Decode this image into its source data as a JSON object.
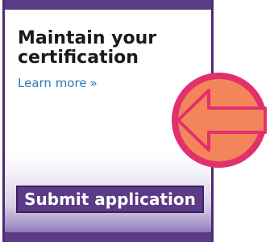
{
  "card": {
    "title": "Maintain your certification",
    "learn_more_label": "Learn more",
    "learn_more_chevron": "»",
    "submit_label": "Submit application"
  },
  "overlay": {
    "icon": "left-arrow-icon",
    "fill_color": "#f4855b",
    "stroke_color": "#e2306b"
  },
  "colors": {
    "brand_purple": "#5b3a86",
    "link_blue": "#2b7ab7"
  }
}
